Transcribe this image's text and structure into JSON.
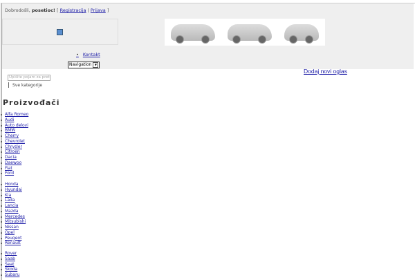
{
  "header": {
    "welcome": "Dobrodošli,",
    "user": "posetioc!",
    "bracket_open": "[",
    "register": "Registracija",
    "sep": "|",
    "login": "Prijava",
    "bracket_close": "]"
  },
  "nav": {
    "items": [
      {
        "label": "Kontakt"
      }
    ],
    "select_value": "Navigation"
  },
  "add_listing": "Dodaj novi oglas",
  "search": {
    "placeholder": "Upišite pojam za pretraživanje",
    "category": "Sve kategorije"
  },
  "manufacturers": {
    "title": "Proizvođači",
    "groups": [
      [
        "Alfa Romeo",
        "Audi",
        "Auto delovi",
        "BMW",
        "Cherry",
        "Chevrolet",
        "Chrysler",
        "Citroen",
        "Dacia",
        "Daewoo",
        "Fiat",
        "Ford"
      ],
      [
        "Honda",
        "Hyundai",
        "Kia",
        "Lada",
        "Lancia",
        "Mazda",
        "Mercedes",
        "Mitsubishi",
        "Nissan",
        "Opel",
        "Peugeot",
        "Renault"
      ],
      [
        "Rover",
        "Saab",
        "Seat",
        "Škoda",
        "Subaru"
      ]
    ]
  }
}
